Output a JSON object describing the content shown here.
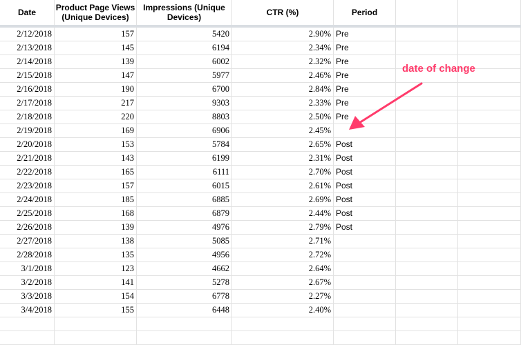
{
  "headers": {
    "date": "Date",
    "views_line1": "Product Page Views",
    "views_line2": "(Unique Devices)",
    "impr_line1": "Impressions (Unique",
    "impr_line2": "Devices)",
    "ctr": "CTR (%)",
    "period": "Period"
  },
  "rows": [
    {
      "date": "2/12/2018",
      "views": "157",
      "impressions": "5420",
      "ctr": "2.90%",
      "period": "Pre"
    },
    {
      "date": "2/13/2018",
      "views": "145",
      "impressions": "6194",
      "ctr": "2.34%",
      "period": "Pre"
    },
    {
      "date": "2/14/2018",
      "views": "139",
      "impressions": "6002",
      "ctr": "2.32%",
      "period": "Pre"
    },
    {
      "date": "2/15/2018",
      "views": "147",
      "impressions": "5977",
      "ctr": "2.46%",
      "period": "Pre"
    },
    {
      "date": "2/16/2018",
      "views": "190",
      "impressions": "6700",
      "ctr": "2.84%",
      "period": "Pre"
    },
    {
      "date": "2/17/2018",
      "views": "217",
      "impressions": "9303",
      "ctr": "2.33%",
      "period": "Pre"
    },
    {
      "date": "2/18/2018",
      "views": "220",
      "impressions": "8803",
      "ctr": "2.50%",
      "period": "Pre"
    },
    {
      "date": "2/19/2018",
      "views": "169",
      "impressions": "6906",
      "ctr": "2.45%",
      "period": ""
    },
    {
      "date": "2/20/2018",
      "views": "153",
      "impressions": "5784",
      "ctr": "2.65%",
      "period": "Post"
    },
    {
      "date": "2/21/2018",
      "views": "143",
      "impressions": "6199",
      "ctr": "2.31%",
      "period": "Post"
    },
    {
      "date": "2/22/2018",
      "views": "165",
      "impressions": "6111",
      "ctr": "2.70%",
      "period": "Post"
    },
    {
      "date": "2/23/2018",
      "views": "157",
      "impressions": "6015",
      "ctr": "2.61%",
      "period": "Post"
    },
    {
      "date": "2/24/2018",
      "views": "185",
      "impressions": "6885",
      "ctr": "2.69%",
      "period": "Post"
    },
    {
      "date": "2/25/2018",
      "views": "168",
      "impressions": "6879",
      "ctr": "2.44%",
      "period": "Post"
    },
    {
      "date": "2/26/2018",
      "views": "139",
      "impressions": "4976",
      "ctr": "2.79%",
      "period": "Post"
    },
    {
      "date": "2/27/2018",
      "views": "138",
      "impressions": "5085",
      "ctr": "2.71%",
      "period": ""
    },
    {
      "date": "2/28/2018",
      "views": "135",
      "impressions": "4956",
      "ctr": "2.72%",
      "period": ""
    },
    {
      "date": "3/1/2018",
      "views": "123",
      "impressions": "4662",
      "ctr": "2.64%",
      "period": ""
    },
    {
      "date": "3/2/2018",
      "views": "141",
      "impressions": "5278",
      "ctr": "2.67%",
      "period": ""
    },
    {
      "date": "3/3/2018",
      "views": "154",
      "impressions": "6778",
      "ctr": "2.27%",
      "period": ""
    },
    {
      "date": "3/4/2018",
      "views": "155",
      "impressions": "6448",
      "ctr": "2.40%",
      "period": ""
    },
    {
      "date": "",
      "views": "",
      "impressions": "",
      "ctr": "",
      "period": ""
    },
    {
      "date": "",
      "views": "",
      "impressions": "",
      "ctr": "",
      "period": ""
    }
  ],
  "annotation": {
    "text": "date of change",
    "color": "#ff3b6b"
  },
  "colors": {
    "gridline": "#e2e2e2",
    "header_divider": "#d9dde2"
  }
}
